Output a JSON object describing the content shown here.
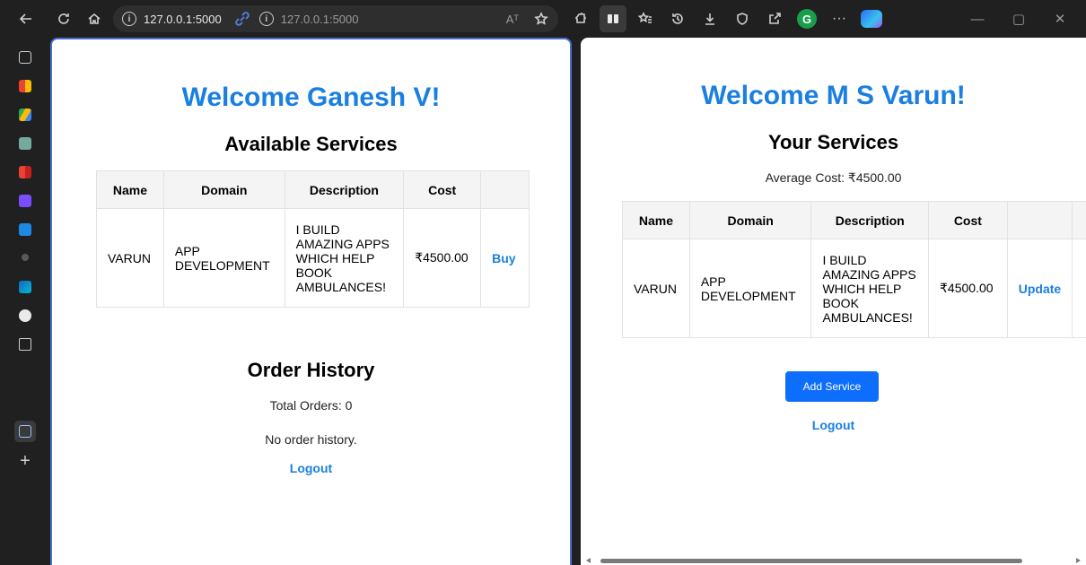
{
  "browser": {
    "url_primary": "127.0.0.1:5000",
    "url_secondary": "127.0.0.1:5000",
    "read_aloud": "Aᵀ",
    "extension_letter": "G",
    "more": "···"
  },
  "left": {
    "welcome": "Welcome Ganesh V!",
    "services_title": "Available Services",
    "table": {
      "headers": [
        "Name",
        "Domain",
        "Description",
        "Cost",
        ""
      ],
      "rows": [
        {
          "name": "VARUN",
          "domain": "APP DEVELOPMENT",
          "description": "I BUILD AMAZING APPS WHICH HELP BOOK AMBULANCES!",
          "cost": "₹4500.00",
          "action": "Buy"
        }
      ]
    },
    "orders_title": "Order History",
    "total_orders": "Total Orders: 0",
    "no_history": "No order history.",
    "logout": "Logout"
  },
  "right": {
    "welcome": "Welcome M S Varun!",
    "services_title": "Your Services",
    "average_cost": "Average Cost: ₹4500.00",
    "table": {
      "headers": [
        "Name",
        "Domain",
        "Description",
        "Cost",
        ""
      ],
      "rows": [
        {
          "name": "VARUN",
          "domain": "APP DEVELOPMENT",
          "description": "I BUILD AMAZING APPS WHICH HELP BOOK AMBULANCES!",
          "cost": "₹4500.00",
          "action": "Update"
        }
      ]
    },
    "add_service": "Add Service",
    "logout": "Logout"
  },
  "colors": {
    "accent": "#1a7fe0",
    "button": "#0d6efd",
    "chrome": "#202020",
    "split_border": "#4a6fd1"
  },
  "icons": [
    "back-icon",
    "refresh-icon",
    "home-icon",
    "info-icon",
    "split-link-icon",
    "favorite-icon",
    "extensions-icon",
    "split-screen-icon",
    "favorites-icon",
    "history-icon",
    "downloads-icon",
    "browser-essentials-icon",
    "share-icon",
    "more-icon",
    "copilot-icon",
    "minimize-icon",
    "restore-icon",
    "close-icon"
  ]
}
